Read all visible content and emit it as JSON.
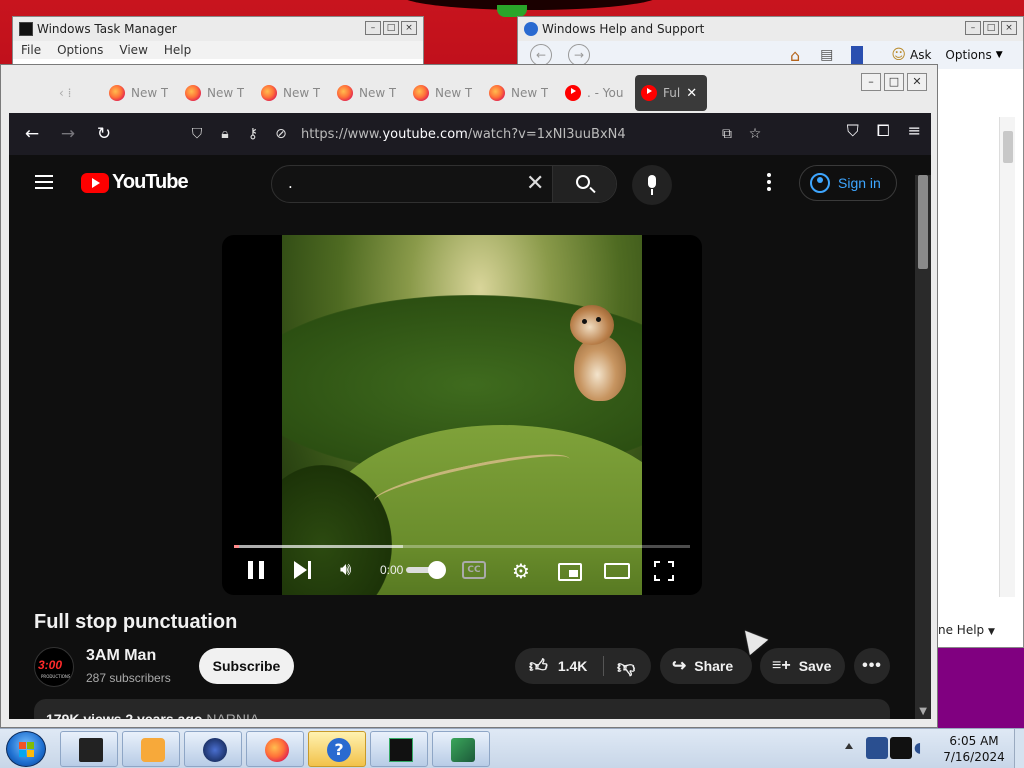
{
  "desktop": {
    "top_accent": "#c8141e"
  },
  "task_manager": {
    "title": "Windows Task Manager",
    "menu": [
      "File",
      "Options",
      "View",
      "Help"
    ]
  },
  "help_support": {
    "title": "Windows Help and Support",
    "toolbar": {
      "ask": "Ask",
      "options": "Options"
    },
    "footer_partial": "ne Help"
  },
  "firefox": {
    "tabs": [
      {
        "label": "New T",
        "favicon": "firefox-icon"
      },
      {
        "label": "New T",
        "favicon": "firefox-icon"
      },
      {
        "label": "New T",
        "favicon": "firefox-icon"
      },
      {
        "label": "New T",
        "favicon": "firefox-icon"
      },
      {
        "label": "New T",
        "favicon": "firefox-icon"
      },
      {
        "label": "New T",
        "favicon": "firefox-icon"
      },
      {
        "label": ". - You",
        "favicon": "youtube-icon"
      },
      {
        "label": "Ful",
        "favicon": "youtube-icon",
        "active": true
      }
    ],
    "url": {
      "prefix": "https://www.",
      "domain": "youtube.com",
      "path": "/watch?v=1xNI3uuBxN4"
    }
  },
  "youtube": {
    "logo_text": "YouTube",
    "search": {
      "value": "."
    },
    "signin_label": "Sign in",
    "player": {
      "time": "0:00",
      "progress_played": 0.01,
      "progress_loaded": 0.37,
      "cc_label": "CC"
    },
    "video": {
      "title": "Full stop punctuation",
      "channel": "3AM Man",
      "subscribers": "287 subscribers",
      "avatar_text": "3:00",
      "avatar_sub": "PRODUCTIONS",
      "subscribe_label": "Subscribe",
      "likes": "1.4K",
      "share_label": "Share",
      "save_label": "Save",
      "description_line": "179K views  2 years ago",
      "description_tag": "NARNIA"
    }
  },
  "taskbar": {
    "clock_time": "6:05 AM",
    "clock_date": "7/16/2024"
  }
}
